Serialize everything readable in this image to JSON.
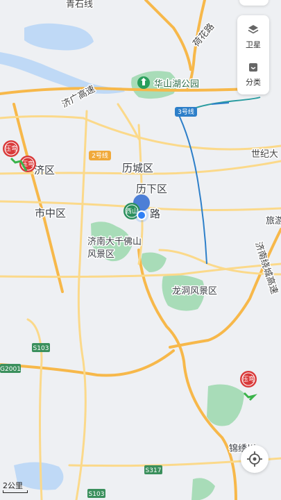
{
  "map_labels": {
    "qingshi": "青石线",
    "hehua": "荷花路",
    "huashanhu": "华山湖公园",
    "jiguang": "济广高速",
    "line3": "3号线",
    "line2": "2号线",
    "shiji": "世纪大",
    "licheng": "历城区",
    "lixia": "历下区",
    "jiqu": "济区",
    "shizhong": "市中区",
    "lu": "路",
    "luyou": "旅游",
    "qianfo1": "济南大千佛山",
    "qianfo2": "风景区",
    "longdong": "龙洞风景区",
    "jinan_ring": "济南绕城高速",
    "jinxiu": "锦绣川",
    "s103a": "S103",
    "s103b": "S103",
    "g2001": "G2001",
    "s317": "S317",
    "toll_badge": "压弯",
    "station_badge": "西山"
  },
  "controls": {
    "satellite": "卫星",
    "category": "分类"
  },
  "scale": "2公里",
  "colors": {
    "expressway": "#f7b84a",
    "major_road": "#fbd98a",
    "water": "#bfd9f6",
    "park": "#a8dcb8",
    "metro_line3": "#2d7fc9",
    "metro_teal": "#2a9ca0",
    "location_dot": "#2f7ff5",
    "pin_red": "#d93a3a"
  },
  "icons": [
    "layers-icon",
    "category-icon",
    "locate-icon",
    "park-pin-icon",
    "toll-pin-icon",
    "location-dot-icon"
  ]
}
